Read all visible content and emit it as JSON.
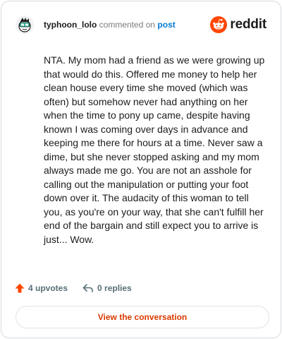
{
  "header": {
    "username": "typhoon_lolo",
    "commented_text": "commented on",
    "post_link": "post",
    "brand": "reddit"
  },
  "comment": {
    "body": "NTA. My mom had a friend as we were growing up that would do this. Offered me money to help her clean house every time she moved (which was often) but somehow never had anything on her when the time to pony up came, despite having known I was coming over days in advance and keeping me there for hours at a time. Never saw a dime, but she never stopped asking and my mom always made me go. You are not an asshole for calling out the manipulation or putting your foot down over it. The audacity of this woman to tell you, as you're on your way, that she can't fulfill her end of the bargain and still expect you to arrive is just... Wow."
  },
  "actions": {
    "upvotes": "4 upvotes",
    "replies": "0 replies"
  },
  "footer": {
    "view_button": "View the conversation"
  },
  "colors": {
    "upvote": "#ff4500",
    "link": "#0079d3",
    "button_text": "#d93a00"
  },
  "icons": {
    "avatar": "snoo-avatar-icon",
    "brand": "reddit-logo-icon",
    "upvote": "upvote-arrow-icon",
    "reply": "reply-arrow-icon"
  }
}
